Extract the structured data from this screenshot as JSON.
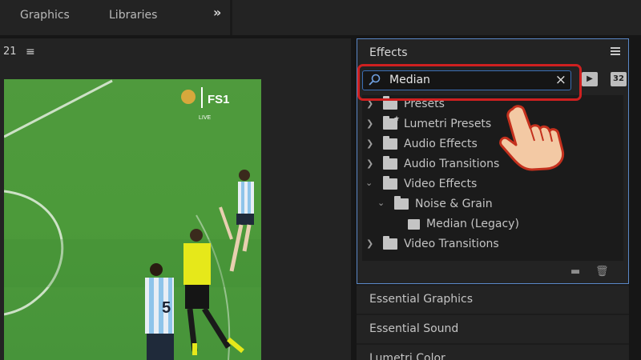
{
  "topbar": {
    "tabs": [
      {
        "label": "Graphics"
      },
      {
        "label": "Libraries"
      }
    ],
    "more_label": "»"
  },
  "monitor": {
    "timecode": "21",
    "menu_icon": "hamburger-icon",
    "video": {
      "broadcaster": "FS1",
      "live": "LIVE",
      "player_number": "5",
      "colors": {
        "grass": "#4c9a3a",
        "referee_shirt": "#e6e81a",
        "stripe": "#8ec4ea"
      }
    }
  },
  "effects": {
    "title": "Effects",
    "search": {
      "value": "Median",
      "icon": "search-icon",
      "clear": "×"
    },
    "header_icons": [
      {
        "name": "accelerated-effects-icon",
        "text": "▶"
      },
      {
        "name": "32-bit-icon",
        "text": "32"
      }
    ],
    "tree": [
      {
        "label": "Presets",
        "indent": 0,
        "expanded": false,
        "icon": "folder-icon"
      },
      {
        "label": "Lumetri Presets",
        "indent": 0,
        "expanded": false,
        "icon": "folder-star-icon"
      },
      {
        "label": "Audio Effects",
        "indent": 0,
        "expanded": false,
        "icon": "folder-icon"
      },
      {
        "label": "Audio Transitions",
        "indent": 0,
        "expanded": false,
        "icon": "folder-icon"
      },
      {
        "label": "Video Effects",
        "indent": 0,
        "expanded": true,
        "icon": "folder-icon"
      },
      {
        "label": "Noise & Grain",
        "indent": 1,
        "expanded": true,
        "icon": "folder-icon"
      },
      {
        "label": "Median (Legacy)",
        "indent": 2,
        "expanded": null,
        "icon": "effect-icon"
      },
      {
        "label": "Video Transitions",
        "indent": 0,
        "expanded": false,
        "icon": "folder-icon"
      }
    ],
    "footer_icons": [
      "new-bin-icon",
      "trash-icon"
    ],
    "accent": "#5a88c7"
  },
  "collapsed_panels": [
    {
      "label": "Essential Graphics"
    },
    {
      "label": "Essential Sound"
    },
    {
      "label": "Lumetri Color"
    }
  ],
  "annotation": {
    "highlight_color": "#cf2020",
    "pointer": "pointing-hand-icon"
  }
}
